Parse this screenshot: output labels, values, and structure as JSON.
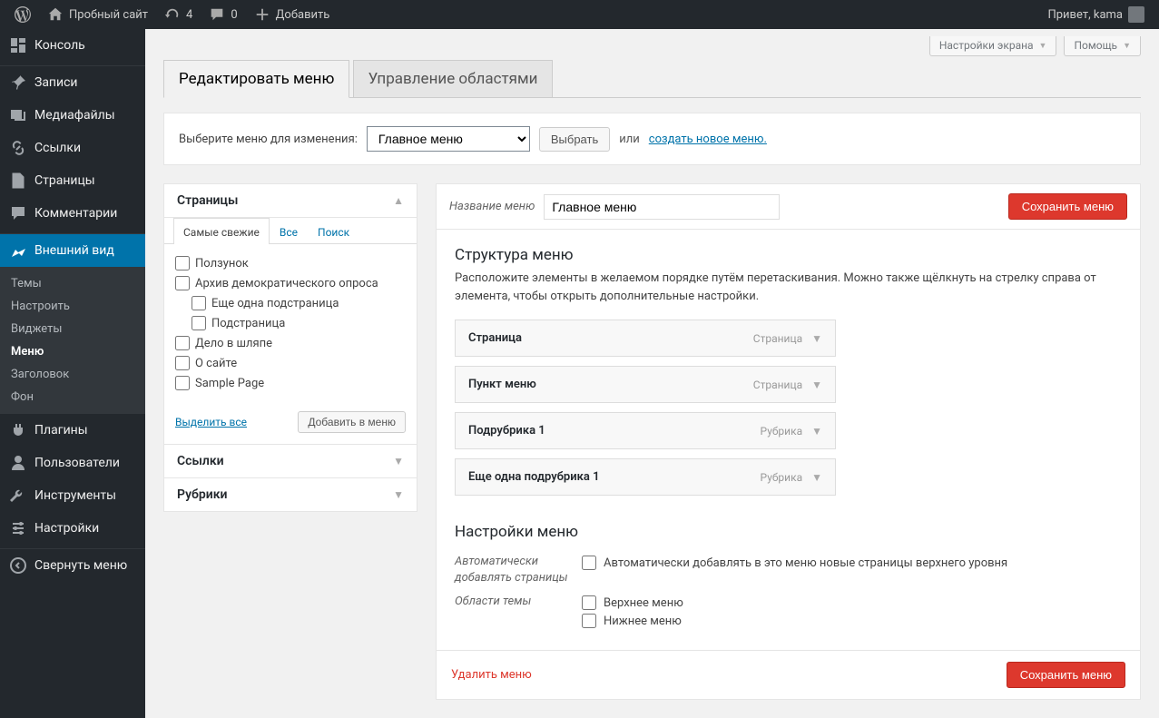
{
  "adminbar": {
    "site_name": "Пробный сайт",
    "updates_count": "4",
    "comments_count": "0",
    "add_new": "Добавить",
    "greeting": "Привет, kama"
  },
  "sidebar": {
    "items": [
      {
        "label": "Консоль",
        "icon": "dashboard"
      },
      {
        "label": "Записи",
        "icon": "pin"
      },
      {
        "label": "Медиафайлы",
        "icon": "media"
      },
      {
        "label": "Ссылки",
        "icon": "link"
      },
      {
        "label": "Страницы",
        "icon": "page"
      },
      {
        "label": "Комментарии",
        "icon": "comment"
      },
      {
        "label": "Внешний вид",
        "icon": "appearance",
        "current": true
      },
      {
        "label": "Плагины",
        "icon": "plugin"
      },
      {
        "label": "Пользователи",
        "icon": "user"
      },
      {
        "label": "Инструменты",
        "icon": "tools"
      },
      {
        "label": "Настройки",
        "icon": "settings"
      },
      {
        "label": "Свернуть меню",
        "icon": "collapse"
      }
    ],
    "submenu": [
      {
        "label": "Темы"
      },
      {
        "label": "Настроить"
      },
      {
        "label": "Виджеты"
      },
      {
        "label": "Меню",
        "current": true
      },
      {
        "label": "Заголовок"
      },
      {
        "label": "Фон"
      }
    ]
  },
  "top_buttons": {
    "screen_options": "Настройки экрана",
    "help": "Помощь"
  },
  "tabs": {
    "edit": "Редактировать меню",
    "locations": "Управление областями"
  },
  "select_bar": {
    "label": "Выберите меню для изменения:",
    "selected": "Главное меню",
    "button": "Выбрать",
    "or": "или",
    "create_link": "создать новое меню"
  },
  "accordion": {
    "pages": {
      "title": "Страницы",
      "tabs": {
        "recent": "Самые свежие",
        "all": "Все",
        "search": "Поиск"
      },
      "items": [
        {
          "label": "Ползунок",
          "indent": false
        },
        {
          "label": "Архив демократического опроса",
          "indent": false
        },
        {
          "label": "Еще одна подстраница",
          "indent": true
        },
        {
          "label": "Подстраница",
          "indent": true
        },
        {
          "label": "Дело в шляпе",
          "indent": false
        },
        {
          "label": "О сайте",
          "indent": false
        },
        {
          "label": "Sample Page",
          "indent": false
        }
      ],
      "select_all": "Выделить все",
      "add_button": "Добавить в меню"
    },
    "links": {
      "title": "Ссылки"
    },
    "categories": {
      "title": "Рубрики"
    }
  },
  "menu_edit": {
    "name_label": "Название меню",
    "name_value": "Главное меню",
    "save_button": "Сохранить меню",
    "structure_heading": "Структура меню",
    "structure_desc": "Расположите элементы в желаемом порядке путём перетаскивания. Можно также щёлкнуть на стрелку справа от элемента, чтобы открыть дополнительные настройки.",
    "items": [
      {
        "title": "Страница",
        "type": "Страница"
      },
      {
        "title": "Пункт меню",
        "type": "Страница"
      },
      {
        "title": "Подрубрика 1",
        "type": "Рубрика"
      },
      {
        "title": "Еще одна подрубрика 1",
        "type": "Рубрика"
      }
    ],
    "settings_heading": "Настройки меню",
    "auto_add_label": "Автоматически добавлять страницы",
    "auto_add_option": "Автоматически добавлять в это меню новые страницы верхнего уровня",
    "locations_label": "Области темы",
    "location_top": "Верхнее меню",
    "location_bottom": "Нижнее меню",
    "delete_link": "Удалить меню"
  }
}
